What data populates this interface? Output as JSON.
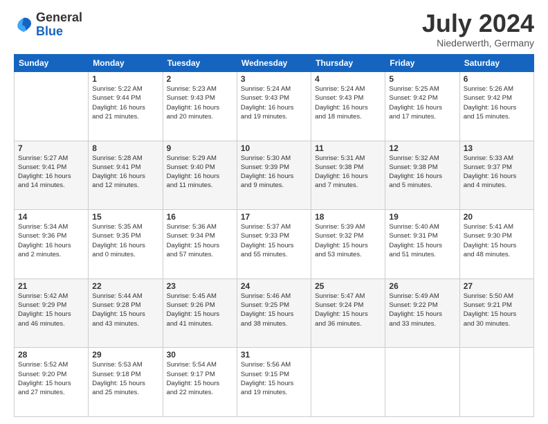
{
  "header": {
    "logo": {
      "line1": "General",
      "line2": "Blue"
    },
    "title": "July 2024",
    "subtitle": "Niederwerth, Germany"
  },
  "days_of_week": [
    "Sunday",
    "Monday",
    "Tuesday",
    "Wednesday",
    "Thursday",
    "Friday",
    "Saturday"
  ],
  "weeks": [
    [
      {
        "day": "",
        "info": ""
      },
      {
        "day": "1",
        "info": "Sunrise: 5:22 AM\nSunset: 9:44 PM\nDaylight: 16 hours\nand 21 minutes."
      },
      {
        "day": "2",
        "info": "Sunrise: 5:23 AM\nSunset: 9:43 PM\nDaylight: 16 hours\nand 20 minutes."
      },
      {
        "day": "3",
        "info": "Sunrise: 5:24 AM\nSunset: 9:43 PM\nDaylight: 16 hours\nand 19 minutes."
      },
      {
        "day": "4",
        "info": "Sunrise: 5:24 AM\nSunset: 9:43 PM\nDaylight: 16 hours\nand 18 minutes."
      },
      {
        "day": "5",
        "info": "Sunrise: 5:25 AM\nSunset: 9:42 PM\nDaylight: 16 hours\nand 17 minutes."
      },
      {
        "day": "6",
        "info": "Sunrise: 5:26 AM\nSunset: 9:42 PM\nDaylight: 16 hours\nand 15 minutes."
      }
    ],
    [
      {
        "day": "7",
        "info": "Sunrise: 5:27 AM\nSunset: 9:41 PM\nDaylight: 16 hours\nand 14 minutes."
      },
      {
        "day": "8",
        "info": "Sunrise: 5:28 AM\nSunset: 9:41 PM\nDaylight: 16 hours\nand 12 minutes."
      },
      {
        "day": "9",
        "info": "Sunrise: 5:29 AM\nSunset: 9:40 PM\nDaylight: 16 hours\nand 11 minutes."
      },
      {
        "day": "10",
        "info": "Sunrise: 5:30 AM\nSunset: 9:39 PM\nDaylight: 16 hours\nand 9 minutes."
      },
      {
        "day": "11",
        "info": "Sunrise: 5:31 AM\nSunset: 9:38 PM\nDaylight: 16 hours\nand 7 minutes."
      },
      {
        "day": "12",
        "info": "Sunrise: 5:32 AM\nSunset: 9:38 PM\nDaylight: 16 hours\nand 5 minutes."
      },
      {
        "day": "13",
        "info": "Sunrise: 5:33 AM\nSunset: 9:37 PM\nDaylight: 16 hours\nand 4 minutes."
      }
    ],
    [
      {
        "day": "14",
        "info": "Sunrise: 5:34 AM\nSunset: 9:36 PM\nDaylight: 16 hours\nand 2 minutes."
      },
      {
        "day": "15",
        "info": "Sunrise: 5:35 AM\nSunset: 9:35 PM\nDaylight: 16 hours\nand 0 minutes."
      },
      {
        "day": "16",
        "info": "Sunrise: 5:36 AM\nSunset: 9:34 PM\nDaylight: 15 hours\nand 57 minutes."
      },
      {
        "day": "17",
        "info": "Sunrise: 5:37 AM\nSunset: 9:33 PM\nDaylight: 15 hours\nand 55 minutes."
      },
      {
        "day": "18",
        "info": "Sunrise: 5:39 AM\nSunset: 9:32 PM\nDaylight: 15 hours\nand 53 minutes."
      },
      {
        "day": "19",
        "info": "Sunrise: 5:40 AM\nSunset: 9:31 PM\nDaylight: 15 hours\nand 51 minutes."
      },
      {
        "day": "20",
        "info": "Sunrise: 5:41 AM\nSunset: 9:30 PM\nDaylight: 15 hours\nand 48 minutes."
      }
    ],
    [
      {
        "day": "21",
        "info": "Sunrise: 5:42 AM\nSunset: 9:29 PM\nDaylight: 15 hours\nand 46 minutes."
      },
      {
        "day": "22",
        "info": "Sunrise: 5:44 AM\nSunset: 9:28 PM\nDaylight: 15 hours\nand 43 minutes."
      },
      {
        "day": "23",
        "info": "Sunrise: 5:45 AM\nSunset: 9:26 PM\nDaylight: 15 hours\nand 41 minutes."
      },
      {
        "day": "24",
        "info": "Sunrise: 5:46 AM\nSunset: 9:25 PM\nDaylight: 15 hours\nand 38 minutes."
      },
      {
        "day": "25",
        "info": "Sunrise: 5:47 AM\nSunset: 9:24 PM\nDaylight: 15 hours\nand 36 minutes."
      },
      {
        "day": "26",
        "info": "Sunrise: 5:49 AM\nSunset: 9:22 PM\nDaylight: 15 hours\nand 33 minutes."
      },
      {
        "day": "27",
        "info": "Sunrise: 5:50 AM\nSunset: 9:21 PM\nDaylight: 15 hours\nand 30 minutes."
      }
    ],
    [
      {
        "day": "28",
        "info": "Sunrise: 5:52 AM\nSunset: 9:20 PM\nDaylight: 15 hours\nand 27 minutes."
      },
      {
        "day": "29",
        "info": "Sunrise: 5:53 AM\nSunset: 9:18 PM\nDaylight: 15 hours\nand 25 minutes."
      },
      {
        "day": "30",
        "info": "Sunrise: 5:54 AM\nSunset: 9:17 PM\nDaylight: 15 hours\nand 22 minutes."
      },
      {
        "day": "31",
        "info": "Sunrise: 5:56 AM\nSunset: 9:15 PM\nDaylight: 15 hours\nand 19 minutes."
      },
      {
        "day": "",
        "info": ""
      },
      {
        "day": "",
        "info": ""
      },
      {
        "day": "",
        "info": ""
      }
    ]
  ]
}
